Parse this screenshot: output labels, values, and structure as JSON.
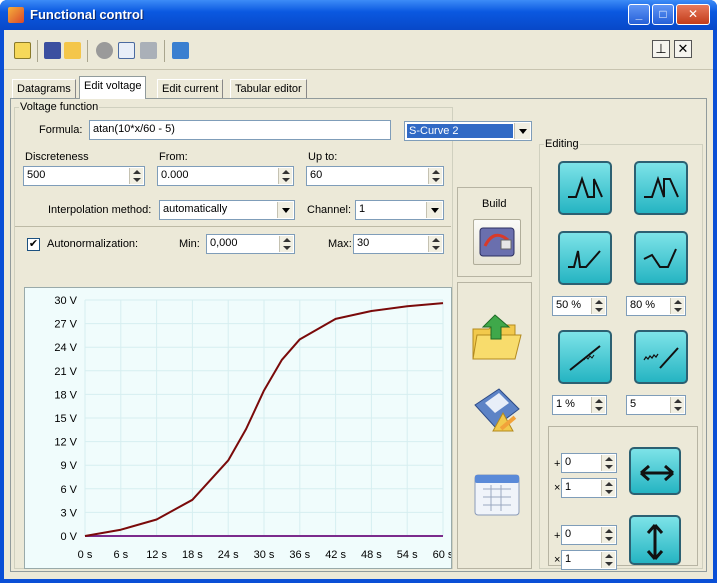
{
  "window": {
    "title": "Functional control"
  },
  "tabs": [
    {
      "label": "Datagrams"
    },
    {
      "label": "Edit voltage"
    },
    {
      "label": "Edit current"
    },
    {
      "label": "Tabular editor"
    }
  ],
  "voltage_function": {
    "group_title": "Voltage function",
    "formula_label": "Formula:",
    "formula_value": "atan(10*x/60 - 5)",
    "curve_preset": "S-Curve 2",
    "discreteness_label": "Discreteness",
    "discreteness_value": "500",
    "from_label": "From:",
    "from_value": "0.000",
    "upto_label": "Up to:",
    "upto_value": "60",
    "interp_label": "Interpolation method:",
    "interp_value": "automatically",
    "channel_label": "Channel:",
    "channel_value": "1",
    "autonorm_label": "Autonormalization:",
    "autonorm_checked": "✔",
    "min_label": "Min:",
    "min_value": "0,000",
    "max_label": "Max:",
    "max_value": "30",
    "build_label": "Build"
  },
  "editing": {
    "title": "Editing",
    "pct_left": "50 %",
    "pct_right": "80 %",
    "val_left": "1 %",
    "val_right": "5",
    "h_offset_sign": "+",
    "h_offset": "0",
    "h_scale_sign": "×",
    "h_scale": "1",
    "v_offset_sign": "+",
    "v_offset": "0",
    "v_scale_sign": "×",
    "v_scale": "1"
  },
  "colors": {
    "curve": "#7a0a0a",
    "baseline": "#7b2b8c",
    "grid": "#d6eef0"
  },
  "chart_data": {
    "type": "line",
    "xlabel": "",
    "ylabel": "",
    "xlim": [
      0,
      60
    ],
    "ylim": [
      0,
      30
    ],
    "x_ticks": [
      "0 s",
      "6 s",
      "12 s",
      "18 s",
      "24 s",
      "30 s",
      "36 s",
      "42 s",
      "48 s",
      "54 s",
      "60 s"
    ],
    "y_ticks": [
      "0 V",
      "3 V",
      "6 V",
      "9 V",
      "12 V",
      "15 V",
      "18 V",
      "21 V",
      "24 V",
      "27 V",
      "30 V"
    ],
    "series": [
      {
        "x": [
          0,
          6,
          12,
          18,
          24,
          27,
          30,
          33,
          36,
          42,
          48,
          54,
          60
        ],
        "y": [
          0,
          0.8,
          2.1,
          4.6,
          9.6,
          13.6,
          18.5,
          22.4,
          25.0,
          27.6,
          28.6,
          29.2,
          29.6
        ]
      },
      {
        "x": [
          0,
          60
        ],
        "y": [
          0,
          0
        ]
      }
    ]
  }
}
